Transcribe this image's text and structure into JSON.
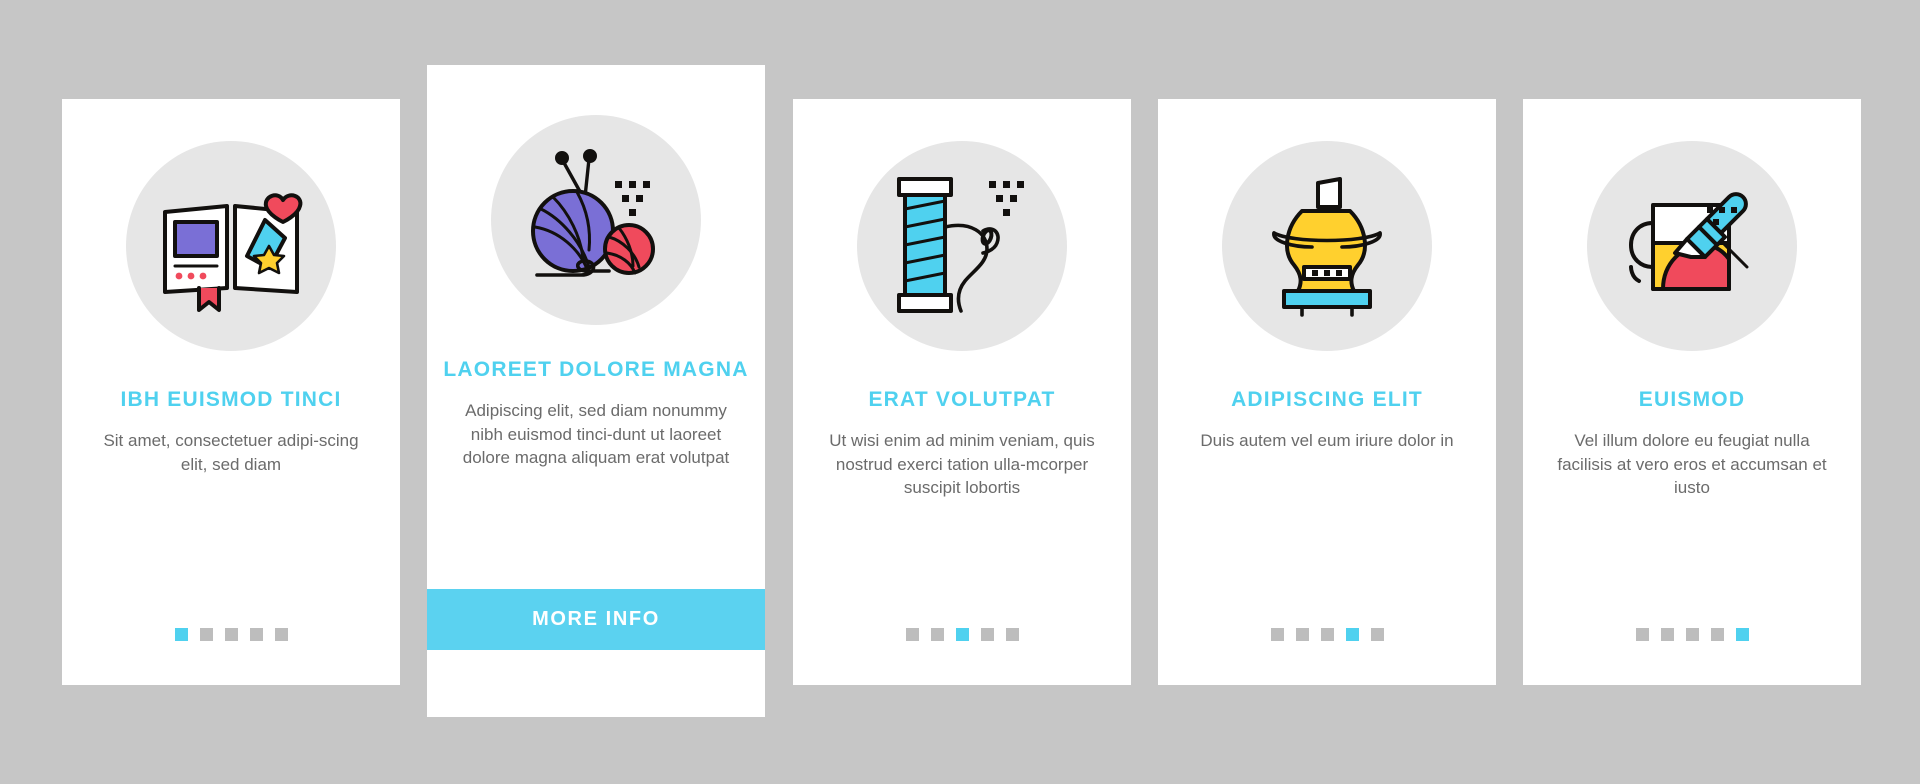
{
  "page": {
    "background_color": "#c6c6c6",
    "card_background": "#ffffff",
    "accent_color": "#4fd1ef",
    "dot_inactive_color": "#bdbdbd",
    "icon_circle_color": "#e6e6e6",
    "body_text_color": "#6b6b6b"
  },
  "cards": [
    {
      "icon_name": "open-book-icon",
      "title": "IBH EUISMOD TINCI",
      "description": "Sit amet, consectetuer adipi-scing elit, sed diam",
      "dots_total": 5,
      "dot_active_index": 0,
      "has_button": false
    },
    {
      "icon_name": "yarn-ball-knitting-icon",
      "title": "LAOREET DOLORE MAGNA",
      "description": "Adipiscing elit, sed diam nonummy nibh euismod tinci-dunt ut laoreet dolore magna aliquam erat volutpat",
      "dots_total": 0,
      "dot_active_index": -1,
      "has_button": true,
      "button_label": "MORE INFO"
    },
    {
      "icon_name": "thread-spool-needle-icon",
      "title": "ERAT VOLUTPAT",
      "description": "Ut wisi enim ad minim veniam, quis nostrud exerci tation ulla-mcorper suscipit lobortis",
      "dots_total": 5,
      "dot_active_index": 2,
      "has_button": false
    },
    {
      "icon_name": "pottery-wheel-vase-icon",
      "title": "ADIPISCING ELIT",
      "description": "Duis autem vel eum iriure dolor in",
      "dots_total": 5,
      "dot_active_index": 3,
      "has_button": false
    },
    {
      "icon_name": "paint-brush-canvas-icon",
      "title": "EUISMOD",
      "description": "Vel illum dolore eu feugiat nulla facilisis at vero eros et accumsan et iusto",
      "dots_total": 5,
      "dot_active_index": 4,
      "has_button": false
    }
  ]
}
